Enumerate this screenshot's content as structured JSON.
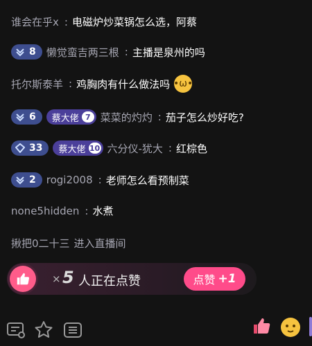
{
  "chat": [
    {
      "user": "谁会在乎x",
      "sep": ":",
      "text": "电磁炉炒菜锅怎么选，阿蔡"
    },
    {
      "level": "8",
      "user": "懒觉蛮吉两三根",
      "sep": ":",
      "text": "主播是泉州的吗"
    },
    {
      "user": "托尔斯泰羊",
      "sep": ":",
      "text": "鸡胸肉有什么做法吗",
      "emoji": "•ω•"
    },
    {
      "level": "6",
      "fan": "蔡大佬",
      "fan_level": "7",
      "user": "菜菜的灼灼",
      "sep": ":",
      "text": "茄子怎么炒好吃?"
    },
    {
      "level": "33",
      "fan": "蔡大佬",
      "fan_level": "10",
      "user": "六分仪-犹大",
      "sep": ":",
      "text": "红棕色"
    },
    {
      "level": "2",
      "user": "rogi2008",
      "sep": ":",
      "text": "老师怎么看预制菜"
    },
    {
      "user": "none5hidden",
      "sep": ":",
      "text": "水煮"
    },
    {
      "user": "揪把0二十三",
      "text": "进入直播间"
    }
  ],
  "like_banner": {
    "multiplier": "×",
    "count": "5",
    "text": "人正在点赞",
    "button": "点赞",
    "button_plus": "+1"
  },
  "toolbar": {
    "icons": [
      "chat-settings-icon",
      "star-effects-icon",
      "list-icon",
      "thumbs-up-icon",
      "emoji-icon"
    ]
  }
}
